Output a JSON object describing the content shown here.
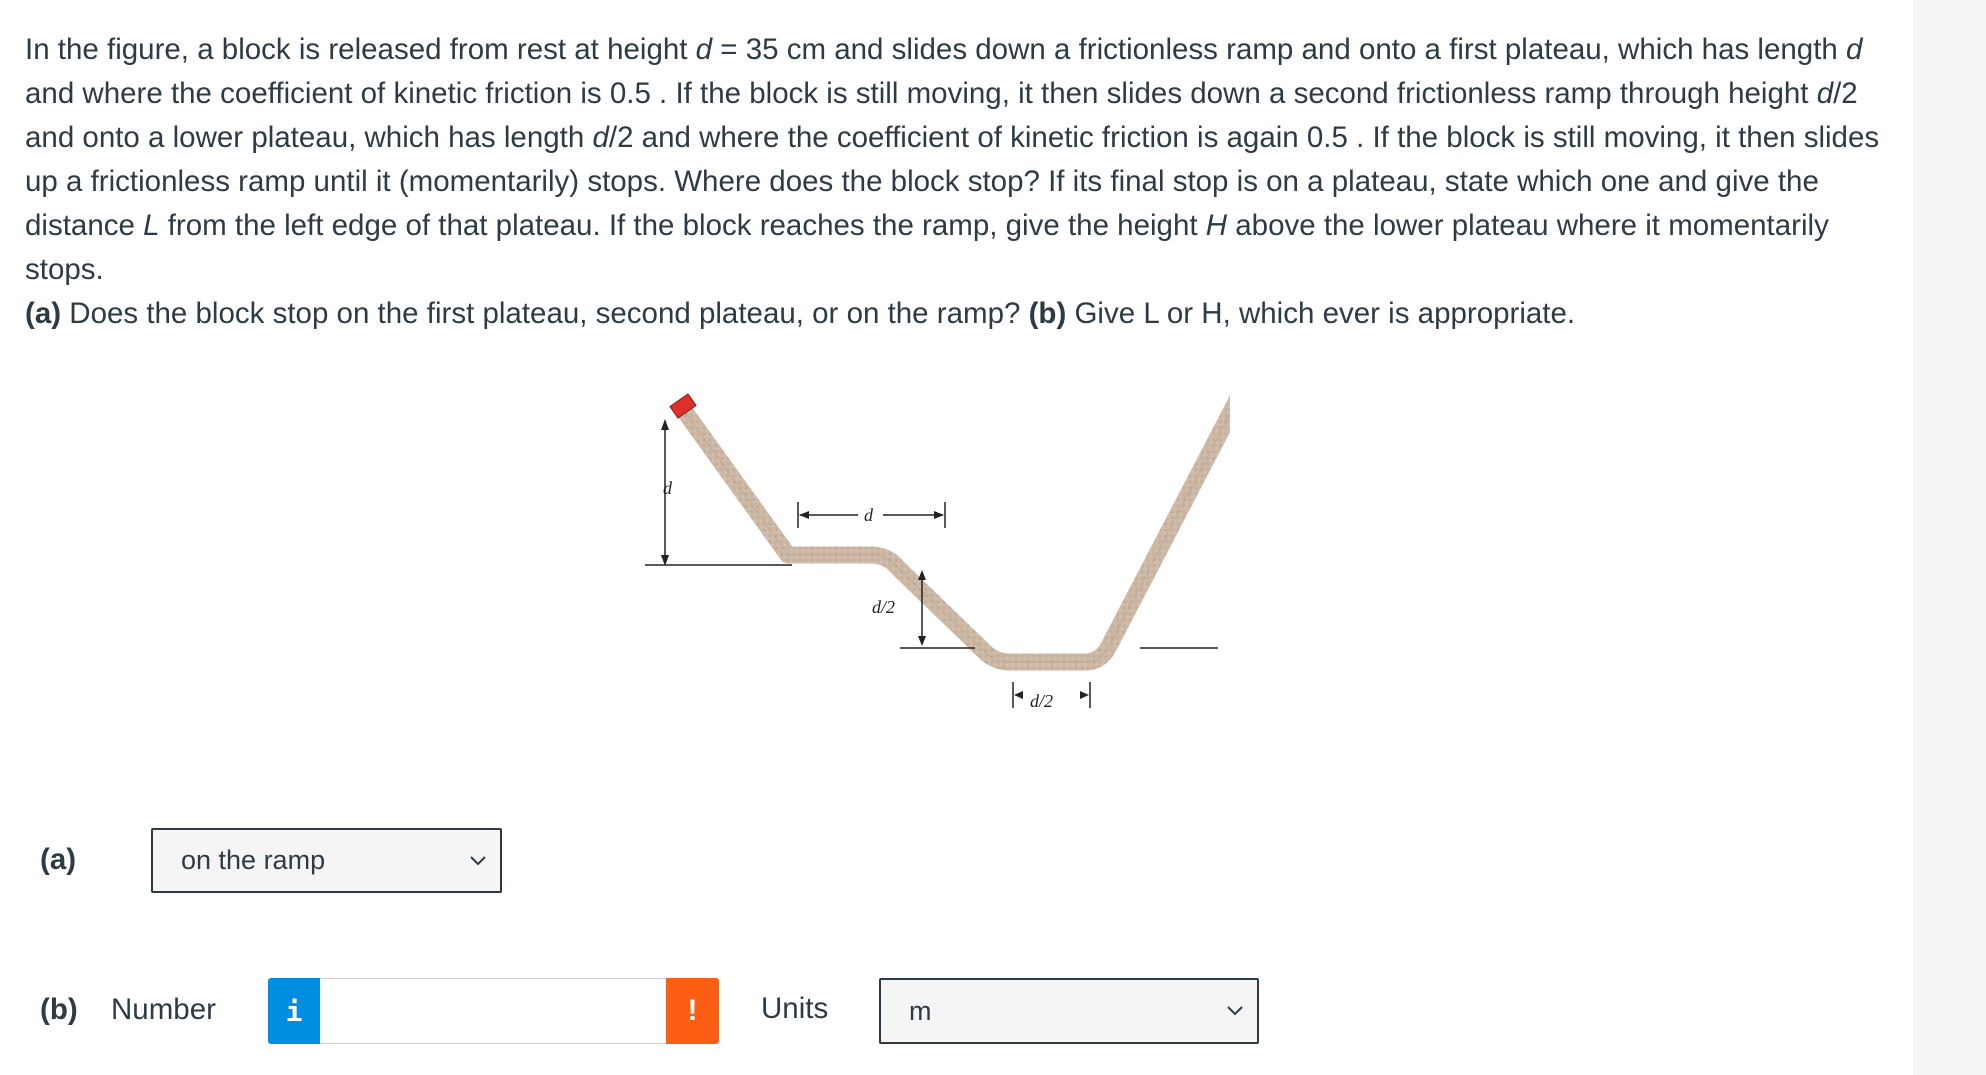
{
  "question": {
    "p1_a": "In the figure, a block is released from rest at height ",
    "p1_d": "d",
    "p1_b": " = 35 cm and slides down a frictionless ramp and onto a first plateau, which has length ",
    "p1_d2": "d",
    "p1_c": " and where the coefficient of kinetic friction is 0.5 . If the block is still moving, it then slides down a second frictionless ramp through height ",
    "p1_d3": "d",
    "p1_e": "/2 and onto a lower plateau, which has length ",
    "p1_d4": "d",
    "p1_f": "/2 and where the coefficient of kinetic friction is again 0.5 . If the block is still moving, it then slides up a frictionless ramp until it (momentarily) stops. Where does the block stop? If its final stop is on a plateau, state which one and give the distance ",
    "p1_L": "L",
    "p1_g": " from the left edge of that plateau. If the block reaches the ramp, give the height ",
    "p1_H": "H",
    "p1_h": " above the lower plateau where it momentarily stops.",
    "p2_a_label": "(a)",
    "p2_a": " Does the block stop on the first plateau, second plateau, or on the ramp? ",
    "p2_b_label": "(b)",
    "p2_b": " Give L or H, which ever is appropriate."
  },
  "figure": {
    "label_d": "d",
    "label_d_span": "d",
    "label_half_height": "d/2",
    "label_half_length": "d/2",
    "colors": {
      "track": "#cdb7a5",
      "block": "#e0302a",
      "line": "#222222"
    }
  },
  "part_a": {
    "label": "(a)",
    "selected": "on the ramp"
  },
  "part_b": {
    "label": "(b)",
    "number_label": "Number",
    "info_icon_text": "i",
    "number_value": "",
    "warning_icon_text": "!",
    "units_label": "Units",
    "units_selected": "m"
  },
  "colors": {
    "info": "#008ee2",
    "warning": "#fc5e13",
    "text": "#2d3b45"
  }
}
